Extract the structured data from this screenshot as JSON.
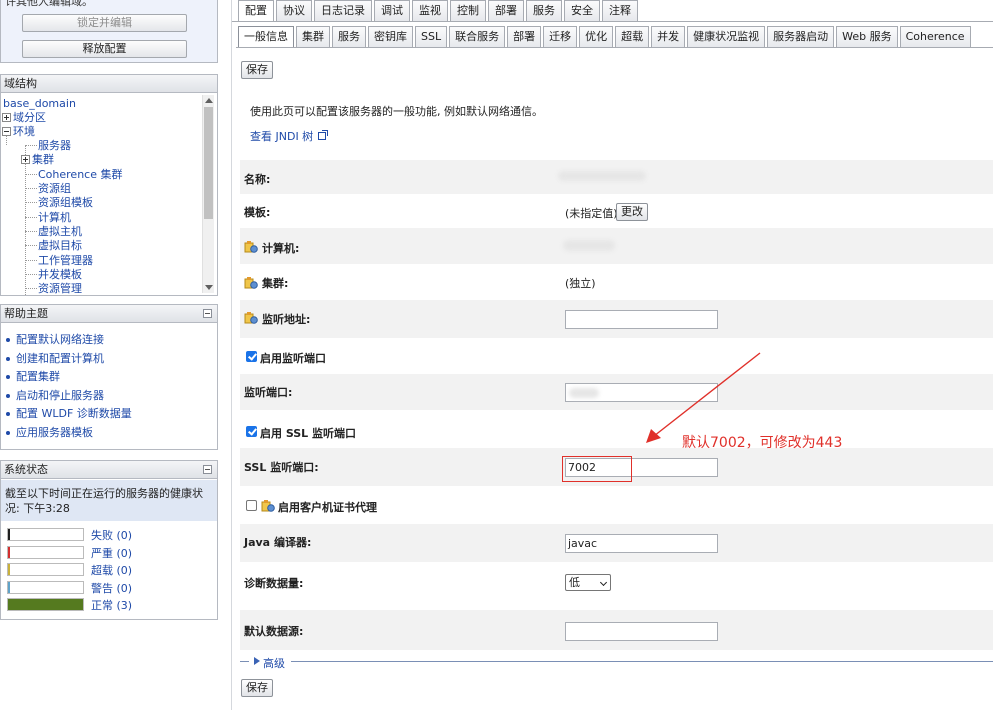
{
  "change_center": {
    "text": "许其他人编辑域。",
    "lock_button": "锁定并编辑",
    "release_button": "释放配置"
  },
  "domain_structure": {
    "title": "域结构",
    "root": "base_domain",
    "nodes": {
      "partitions": "域分区",
      "environment": "环境",
      "servers": "服务器",
      "clusters": "集群",
      "coherence_clusters": "Coherence 集群",
      "resource_groups": "资源组",
      "resource_group_templates": "资源组模板",
      "machines": "计算机",
      "virtual_hosts": "虚拟主机",
      "virtual_targets": "虚拟目标",
      "work_managers": "工作管理器",
      "concurrent_templates": "并发模板",
      "resource_management": "资源管理"
    }
  },
  "help_topics": {
    "title": "帮助主题",
    "items": [
      "配置默认网络连接",
      "创建和配置计算机",
      "配置集群",
      "启动和停止服务器",
      "配置 WLDF 诊断数据量",
      "应用服务器模板"
    ]
  },
  "system_status": {
    "title": "系统状态",
    "message": "截至以下时间正在运行的服务器的健康状况: 下午3:28",
    "rows": [
      {
        "label": "失败 (0)",
        "color": "#1f1f1f",
        "count": 0
      },
      {
        "label": "严重 (0)",
        "color": "#d32f2f",
        "count": 0
      },
      {
        "label": "超载 (0)",
        "color": "#c9b13a",
        "count": 0
      },
      {
        "label": "警告 (0)",
        "color": "#5fa3c9",
        "count": 0
      },
      {
        "label": "正常 (3)",
        "color": "#557a1f",
        "count": 3
      }
    ]
  },
  "tabs_main": [
    "配置",
    "协议",
    "日志记录",
    "调试",
    "监视",
    "控制",
    "部署",
    "服务",
    "安全",
    "注释"
  ],
  "tabs_sub": [
    "一般信息",
    "集群",
    "服务",
    "密钥库",
    "SSL",
    "联合服务",
    "部署",
    "迁移",
    "优化",
    "超载",
    "并发",
    "健康状况监视",
    "服务器启动",
    "Web 服务",
    "Coherence"
  ],
  "buttons": {
    "save": "保存",
    "change": "更改"
  },
  "description": "使用此页可以配置该服务器的一般功能, 例如默认网络通信。",
  "jndi_link": "查看 JNDI 树",
  "form": {
    "name_label": "名称:",
    "template_label": "模板:",
    "template_value": "(未指定值)",
    "machine_label": "计算机:",
    "cluster_label": "集群:",
    "cluster_value": "(独立)",
    "listen_address_label": "监听地址:",
    "listen_address_value": "",
    "enable_listen_port_label": "启用监听端口",
    "enable_listen_port_checked": true,
    "listen_port_label": "监听端口:",
    "enable_ssl_port_label": "启用 SSL 监听端口",
    "enable_ssl_port_checked": true,
    "ssl_port_label": "SSL 监听端口:",
    "ssl_port_value": "7002",
    "client_cert_proxy_label": "启用客户机证书代理",
    "client_cert_proxy_checked": false,
    "java_compiler_label": "Java 编译器:",
    "java_compiler_value": "javac",
    "diagnostic_volume_label": "诊断数据量:",
    "diagnostic_volume_value": "低",
    "default_datasource_label": "默认数据源:",
    "default_datasource_value": ""
  },
  "advanced_label": "高级",
  "annotation": {
    "text": "默认7002，可修改为443",
    "color": "#e0302a"
  }
}
